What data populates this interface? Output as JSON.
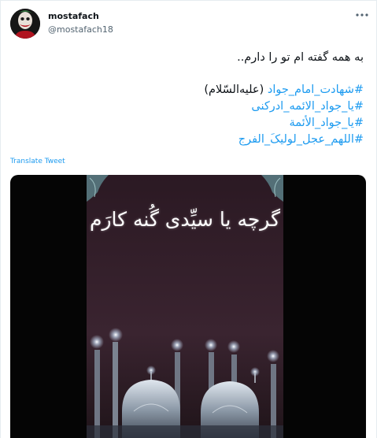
{
  "author": {
    "display_name": "mostafach",
    "handle": "@mostafach18"
  },
  "tweet": {
    "text_line": "به همه گفته ام تو را دارم..",
    "hashtag_lines": [
      {
        "tag": "#شهادت_امام_جواد",
        "suffix": " (علیه‌السّلام)"
      },
      {
        "tag": "#یا_جواد_الائمه_ادرکنی",
        "suffix": ""
      },
      {
        "tag": "#یا_جواد_الأئمة",
        "suffix": ""
      },
      {
        "tag": "#اللهم_عجل_لولیکَ_الفرج",
        "suffix": ""
      }
    ],
    "translate_label": "Translate Tweet"
  },
  "media": {
    "overlay_text": "گرچه یا سیِّدی گُنه کارَم"
  },
  "colors": {
    "link": "#1d9bf0",
    "text": "#0f1419",
    "secondary": "#536471",
    "media_background": "#050505",
    "video_sky": "#2a1a22"
  },
  "icons": {
    "more": "more-dots-icon"
  }
}
